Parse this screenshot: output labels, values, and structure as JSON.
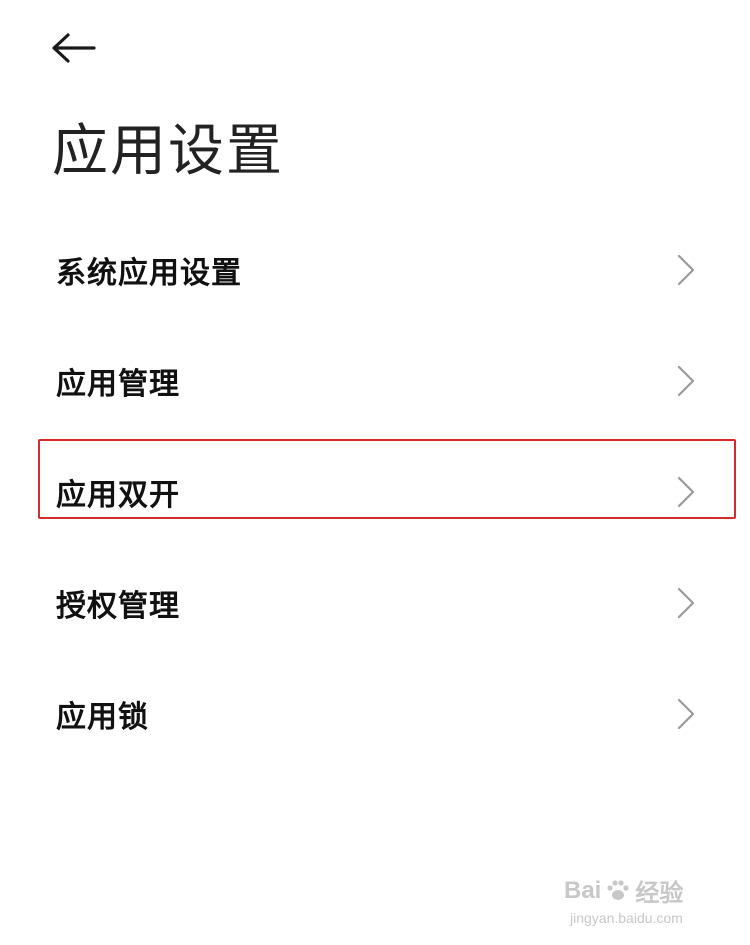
{
  "header": {
    "back_icon": "arrow-left-icon",
    "title": "应用设置"
  },
  "menu": {
    "items": [
      {
        "label": "系统应用设置",
        "icon": "chevron-right-icon"
      },
      {
        "label": "应用管理",
        "icon": "chevron-right-icon"
      },
      {
        "label": "应用双开",
        "icon": "chevron-right-icon",
        "highlighted": true
      },
      {
        "label": "授权管理",
        "icon": "chevron-right-icon"
      },
      {
        "label": "应用锁",
        "icon": "chevron-right-icon"
      }
    ]
  },
  "highlight": {
    "color": "#d62b2b"
  },
  "watermark": {
    "brand": "Bai",
    "brand_suffix": "经验",
    "url": "jingyan.baidu.com"
  }
}
